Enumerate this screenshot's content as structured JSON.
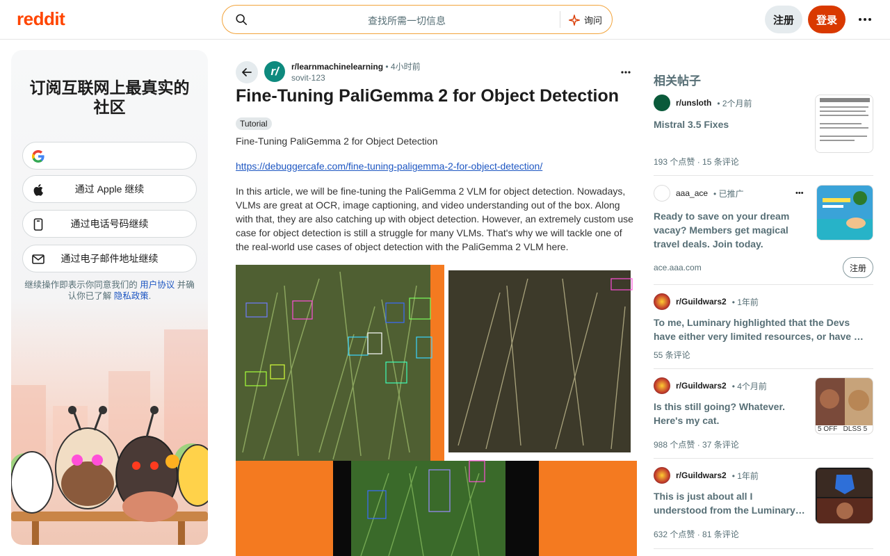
{
  "header": {
    "logo": "reddit",
    "search_placeholder": "查找所需一切信息",
    "ask_label": "询问",
    "signup_label": "注册",
    "login_label": "登录",
    "more_label": "•••"
  },
  "left": {
    "title": "订阅互联网上最真实的社区",
    "google_label": "",
    "apple_label": "通过 Apple 继续",
    "phone_label": "通过电话号码继续",
    "email_label": "通过电子邮件地址继续",
    "legal_prefix": "继续操作即表示你同意我们的 ",
    "legal_terms": "用户协议",
    "legal_mid": " 并确认你已了解 ",
    "legal_privacy": "隐私政策",
    "legal_suffix": "."
  },
  "post": {
    "subreddit": "r/learnmachinelearning",
    "dot": " • ",
    "time": "4小时前",
    "author": "sovit-123",
    "avatar_text": "r/",
    "more": "•••",
    "title": "Fine-Tuning PaliGemma 2 for Object Detection",
    "flair": "Tutorial",
    "subtitle": "Fine-Tuning PaliGemma 2 for Object Detection",
    "link": "https://debuggercafe.com/fine-tuning-paligemma-2-for-object-detection/",
    "body": "In this article, we will be fine-tuning the PaliGemma 2 VLM for object detection. Nowadays, VLMs are great at OCR, image captioning, and video understanding out of the box. Along with that, they are also catching up with object detection. However, an extremely custom use case for object detection is still a struggle for many VLMs. That's why we will tackle one of the real-world use cases of object detection with the PaliGemma 2 VLM here."
  },
  "related": {
    "heading": "相关帖子",
    "items": [
      {
        "sub": "r/unsloth",
        "time": "• 2个月前",
        "title": "Mistral 3.5 Fixes",
        "stats": "193 个点赞  ·  15 条评论"
      },
      {
        "sub": "aaa_ace",
        "time": "• 已推广",
        "title": "Ready to save on your dream vacay? Members get magical travel deals. Join today.",
        "stats": "ace.aaa.com",
        "cta": "注册",
        "more": "•••"
      },
      {
        "sub": "r/Guildwars2",
        "time": "• 1年前",
        "title": "To me, Luminary highlighted that the Devs have either very limited resources, or have …",
        "stats": "55 条评论"
      },
      {
        "sub": "r/Guildwars2",
        "time": "• 4个月前",
        "title": "Is this still going? Whatever. Here's my cat.",
        "stats": "988 个点赞  ·  37 条评论",
        "thumb_text": "5 OFF   DLSS 5"
      },
      {
        "sub": "r/Guildwars2",
        "time": "• 1年前",
        "title": "This is just about all I understood from the Luminary…",
        "stats": "632 个点赞  ·  81 条评论"
      }
    ]
  },
  "colors": {
    "brand": "#ff4500",
    "login": "#d93900",
    "link": "#1d56c2",
    "search_border": "#f2a33a"
  }
}
